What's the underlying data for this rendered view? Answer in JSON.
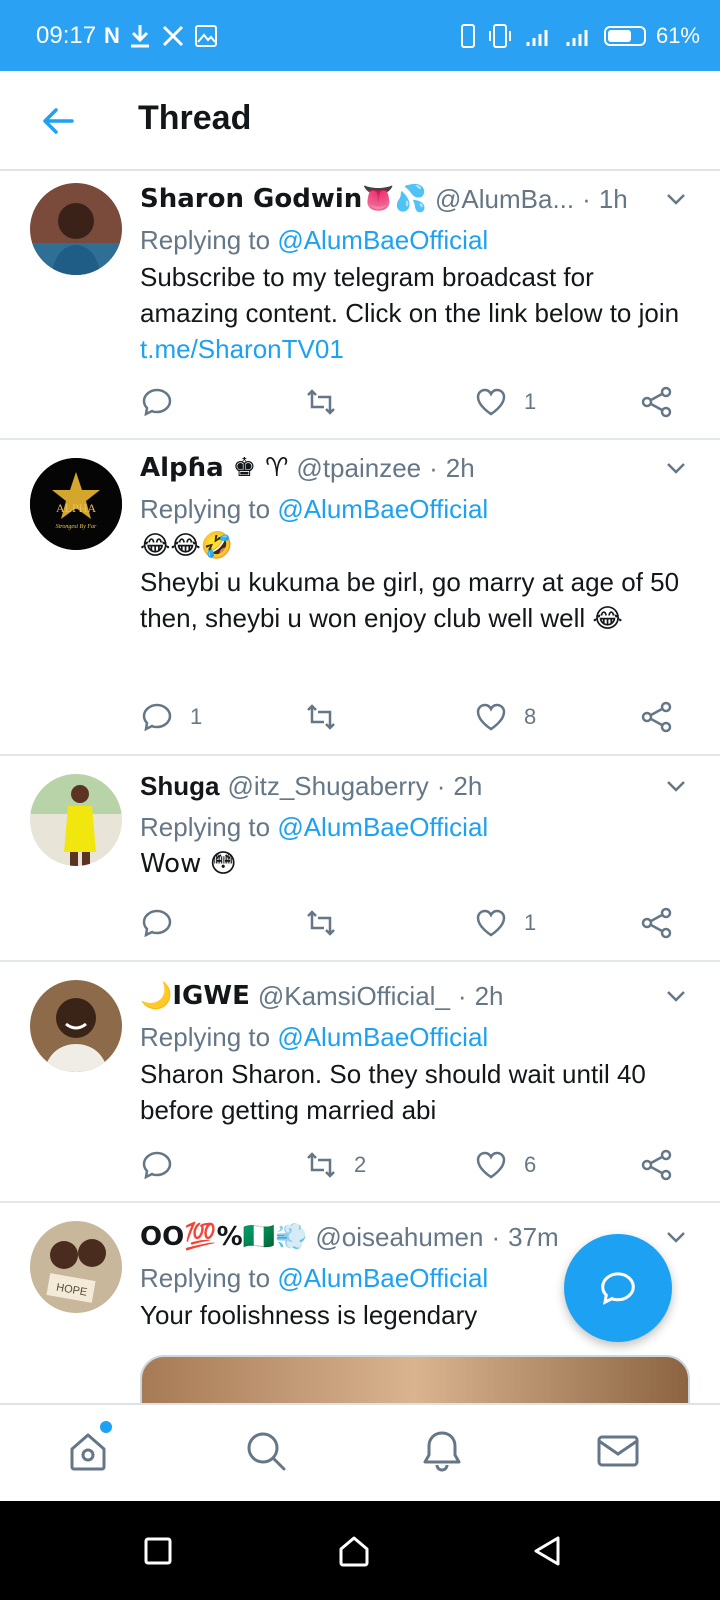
{
  "status_bar": {
    "time": "09:17",
    "battery": "61%",
    "left_icons": [
      "netflix-icon",
      "download-icon",
      "x-icon",
      "image-icon"
    ],
    "right_icons": [
      "phone-icon",
      "vibrate-icon",
      "signal-icon",
      "signal-icon",
      "battery-icon"
    ]
  },
  "header": {
    "title": "Thread",
    "back_icon": "arrow-left-icon"
  },
  "tweets": [
    {
      "name": "Sharon Godwin👅💦",
      "handle": "@AlumBa...",
      "time": "1h",
      "replying_label": "Replying to",
      "replying_to": "@AlumBaeOfficial",
      "text": "Subscribe to my telegram broadcast for amazing content. Click on the link below to join ",
      "link": "t.me/SharonTV01",
      "replies": "",
      "retweets": "",
      "likes": "1"
    },
    {
      "name": "Alpɦa ♚ ♈",
      "handle": "@tpainzee",
      "time": "2h",
      "replying_label": "Replying to",
      "replying_to": "@AlumBaeOfficial",
      "text_emoji": "😂😂🤣",
      "text": "Sheybi u kukuma be girl, go marry at age of 50 then, sheybi u won enjoy club well well 😂",
      "replies": "1",
      "retweets": "",
      "likes": "8"
    },
    {
      "name": "Shuga",
      "handle": "@itz_Shugaberry",
      "time": "2h",
      "replying_label": "Replying to",
      "replying_to": "@AlumBaeOfficial",
      "text": "Wow 😳",
      "replies": "",
      "retweets": "",
      "likes": "1"
    },
    {
      "name": "🌙IGWE",
      "handle": "@KamsiOfficial_",
      "time": "2h",
      "replying_label": "Replying to",
      "replying_to": "@AlumBaeOfficial",
      "text": "Sharon Sharon. So they should wait until 40 before getting married abi",
      "replies": "",
      "retweets": "2",
      "likes": "6"
    },
    {
      "name": "OO💯%🇳🇬💨",
      "handle": "@oiseahumen",
      "time": "37m",
      "replying_label": "Replying to",
      "replying_to": "@AlumBaeOfficial",
      "text": "Your foolishness is legendary"
    }
  ],
  "avatar_text": {
    "alpha_logo": "ALPHA",
    "alpha_tagline": "Strongest By Far",
    "hope_sign": "HOPE"
  },
  "colors": {
    "status_bar": "#2aa1f2",
    "accent": "#1da1f2",
    "secondary_text": "#657786"
  }
}
